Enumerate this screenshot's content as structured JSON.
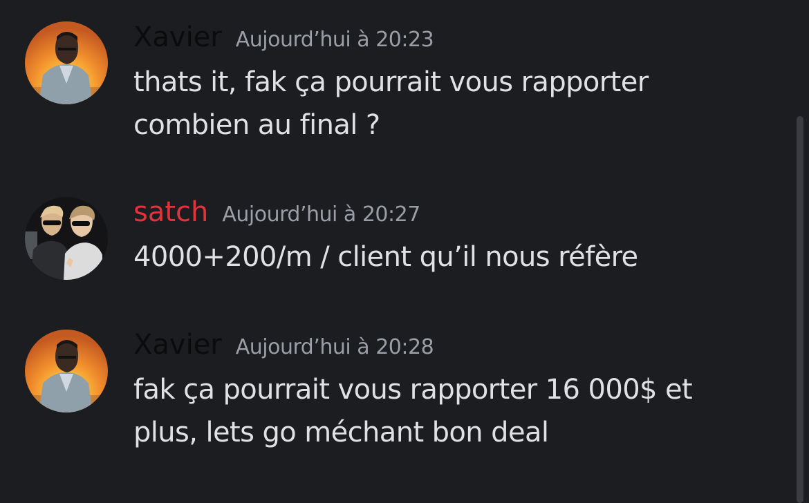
{
  "colors": {
    "background": "#1c1d21",
    "timestamp": "#9b9ea6",
    "message_text": "#dfe1e5",
    "scrollbar_thumb": "#3b3c42"
  },
  "messages": [
    {
      "author": "Xavier",
      "author_color": "#0b0b0c",
      "timestamp": "Aujourd’hui à 20:23",
      "text": "thats it, fak ça pourrait vous rapporter combien au final ?",
      "avatar": "avatar-xavier"
    },
    {
      "author": "satch",
      "author_color": "#e0333a",
      "timestamp": "Aujourd’hui à 20:27",
      "text": "4000+200/m / client qu’il nous réfère",
      "avatar": "avatar-satch"
    },
    {
      "author": "Xavier",
      "author_color": "#0b0b0c",
      "timestamp": "Aujourd’hui à 20:28",
      "text": "fak ça pourrait vous rapporter 16 000$ et plus, lets go méchant bon deal",
      "avatar": "avatar-xavier"
    }
  ]
}
